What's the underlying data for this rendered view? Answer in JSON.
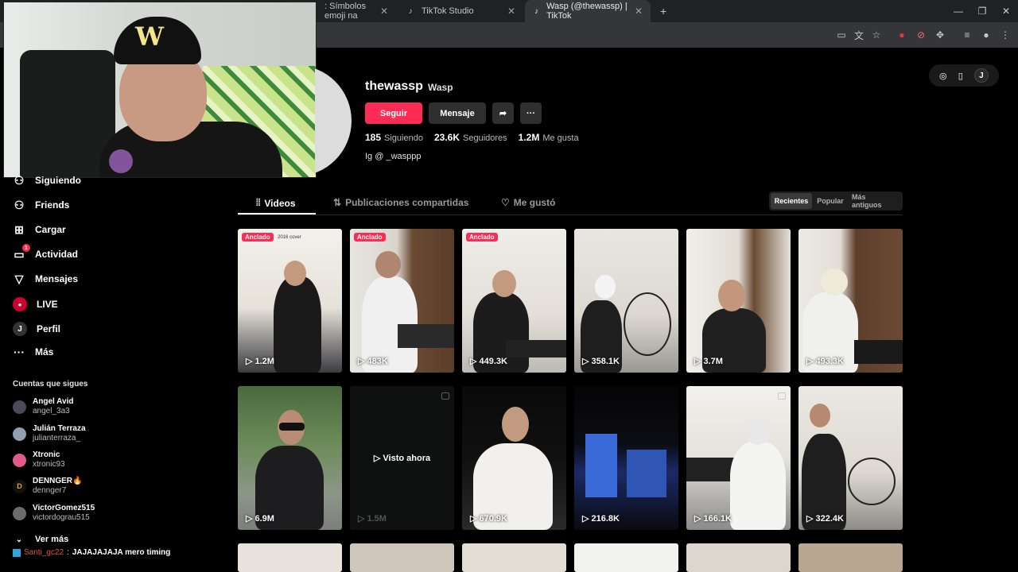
{
  "browser": {
    "tabs": [
      {
        "label": ": Símbolos emoji na",
        "active": false
      },
      {
        "label": "TikTok Studio",
        "active": false
      },
      {
        "label": "Wasp (@thewassp) | TikTok",
        "active": true
      }
    ],
    "new_tab": "+"
  },
  "sidebar": {
    "items": [
      {
        "label": "Siguiendo",
        "icon": "following-icon"
      },
      {
        "label": "Friends",
        "icon": "friends-icon"
      },
      {
        "label": "Cargar",
        "icon": "upload-icon"
      },
      {
        "label": "Actividad",
        "icon": "activity-icon",
        "badge": "1"
      },
      {
        "label": "Mensajes",
        "icon": "messages-icon"
      },
      {
        "label": "LIVE",
        "icon": "live-icon"
      },
      {
        "label": "Perfil",
        "icon": "profile-icon"
      },
      {
        "label": "Más",
        "icon": "more-icon"
      }
    ],
    "following_title": "Cuentas que sigues",
    "accounts": [
      {
        "name": "Angel Avid",
        "handle": "angel_3a3"
      },
      {
        "name": "Julián Terraza",
        "handle": "julianterraza_"
      },
      {
        "name": "Xtronic",
        "handle": "xtronic93"
      },
      {
        "name": "DENNGER🔥",
        "handle": "dennger7"
      },
      {
        "name": "VictorGomez515",
        "handle": "victordograu515"
      }
    ],
    "see_more": "Ver más"
  },
  "chat": {
    "user": "Santi_gc22",
    "sep": ":",
    "message": "JAJAJAJAJA mero timing"
  },
  "profile": {
    "username": "thewassp",
    "display_name": "Wasp",
    "follow_label": "Seguir",
    "message_label": "Mensaje",
    "following_count": "185",
    "following_label": "Siguiendo",
    "followers_count": "23.6K",
    "followers_label": "Seguidores",
    "likes_count": "1.2M",
    "likes_label": "Me gusta",
    "bio": "Ig @ _wasppp"
  },
  "tabs": {
    "videos": "Videos",
    "reposts": "Publicaciones compartidas",
    "liked": "Me gustó"
  },
  "sort": {
    "options": [
      "Recientes",
      "Popular",
      "Más antiguos"
    ],
    "selected": "Recientes"
  },
  "videos": [
    {
      "views": "1.2M",
      "pinned": "Anclado",
      "caption": "2016 cover"
    },
    {
      "views": "483K",
      "pinned": "Anclado"
    },
    {
      "views": "449.3K",
      "pinned": "Anclado"
    },
    {
      "views": "358.1K"
    },
    {
      "views": "3.7M"
    },
    {
      "views": "493.3K"
    },
    {
      "views": "6.9M"
    },
    {
      "views": "1.5M",
      "overlay": "Visto ahora"
    },
    {
      "views": "670.9K"
    },
    {
      "views": "216.8K"
    },
    {
      "views": "166.1K"
    },
    {
      "views": "322.4K"
    }
  ],
  "colors": {
    "accent": "#fe2c55",
    "background": "#000000"
  }
}
